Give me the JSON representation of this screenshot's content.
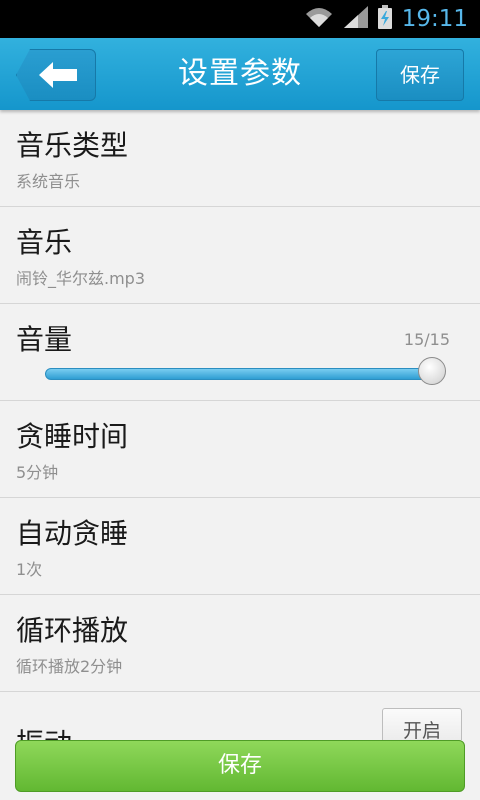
{
  "status_bar": {
    "time": "19:11"
  },
  "header": {
    "title": "设置参数",
    "save_label": "保存",
    "back_icon": "back-arrow-icon"
  },
  "settings": {
    "music_type": {
      "title": "音乐类型",
      "value": "系统音乐"
    },
    "music": {
      "title": "音乐",
      "value": "闹铃_华尔兹.mp3"
    },
    "volume": {
      "title": "音量",
      "value_text": "15/15",
      "level": 1.0
    },
    "snooze_time": {
      "title": "贪睡时间",
      "value": "5分钟"
    },
    "auto_snooze": {
      "title": "自动贪睡",
      "value": "1次"
    },
    "loop_play": {
      "title": "循环播放",
      "value": "循环播放2分钟"
    },
    "vibrate": {
      "title": "振动",
      "toggle_label": "开启"
    }
  },
  "footer": {
    "save_label": "保存"
  },
  "colors": {
    "header": "#1e9fd4",
    "save_green": "#6fc13c",
    "slider_blue": "#3aa9dc"
  }
}
